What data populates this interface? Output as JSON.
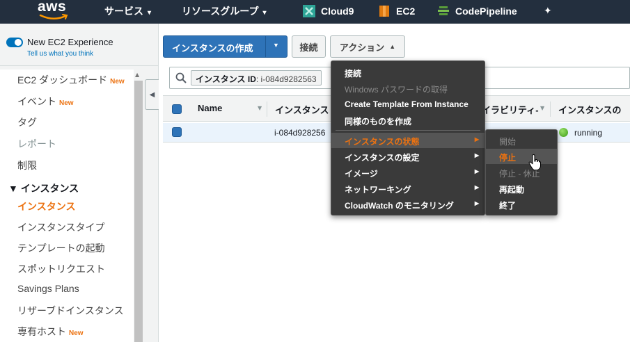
{
  "topnav": {
    "logo": "aws",
    "services": "サービス",
    "resource_groups": "リソースグループ",
    "bookmarks": [
      {
        "label": "Cloud9",
        "color": "#2ea597",
        "icon": "cloud9-icon"
      },
      {
        "label": "EC2",
        "color": "#e07b10",
        "icon": "ec2-icon"
      },
      {
        "label": "CodePipeline",
        "color": "#5a9e3a",
        "icon": "codepipeline-icon"
      }
    ]
  },
  "sidebar": {
    "new_experience": "New EC2 Experience",
    "tell_us": "Tell us what you think",
    "items": [
      {
        "label": "EC2 ダッシュボード",
        "badge": "New"
      },
      {
        "label": "イベント",
        "badge": "New"
      },
      {
        "label": "タグ",
        "badge": ""
      },
      {
        "label": "レポート",
        "badge": ""
      },
      {
        "label": "制限",
        "badge": ""
      }
    ],
    "group": "▼ インスタンス",
    "sub_items": [
      {
        "label": "インスタンス",
        "badge": ""
      },
      {
        "label": "インスタンスタイプ",
        "badge": ""
      },
      {
        "label": "テンプレートの起動",
        "badge": ""
      },
      {
        "label": "スポットリクエスト",
        "badge": ""
      },
      {
        "label": "Savings Plans",
        "badge": ""
      },
      {
        "label": "リザーブドインスタンス",
        "badge": ""
      },
      {
        "label": "専有ホスト",
        "badge": "New"
      }
    ]
  },
  "toolbar": {
    "create": "インスタンスの作成",
    "connect": "接続",
    "actions": "アクション"
  },
  "search": {
    "token_key": "インスタンス ID",
    "token_value": ": i-084d9282563"
  },
  "table": {
    "headers": [
      "Name",
      "インスタンス",
      "イラビリティ-",
      "インスタンスの"
    ],
    "row": {
      "instance_id": "i-084d928256",
      "status": "running"
    }
  },
  "actions_menu": {
    "items": [
      {
        "label": "接続",
        "disabled": false
      },
      {
        "label": "Windows パスワードの取得",
        "disabled": true
      },
      {
        "label": "Create Template From Instance",
        "disabled": false
      },
      {
        "label": "同様のものを作成",
        "disabled": false
      }
    ],
    "submenus": [
      {
        "label": "インスタンスの状態"
      },
      {
        "label": "インスタンスの設定"
      },
      {
        "label": "イメージ"
      },
      {
        "label": "ネットワーキング"
      },
      {
        "label": "CloudWatch のモニタリング"
      }
    ]
  },
  "state_menu": {
    "items": [
      {
        "label": "開始",
        "disabled": true
      },
      {
        "label": "停止",
        "disabled": false
      },
      {
        "label": "停止 - 休止",
        "disabled": true
      },
      {
        "label": "再起動",
        "disabled": false
      },
      {
        "label": "終了",
        "disabled": false
      }
    ]
  },
  "colors": {
    "nav_bg": "#232f3e",
    "primary": "#2e73b8",
    "accent_orange": "#ec7211",
    "menu_bg": "#3a3a3a",
    "running_green": "#3c9b16"
  }
}
